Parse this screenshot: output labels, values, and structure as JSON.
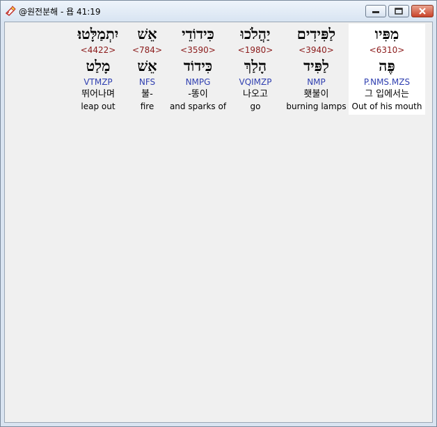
{
  "window": {
    "title": "@원전분해 - 욥 41:19",
    "controls": {
      "minimize": "minimize",
      "maximize": "maximize",
      "close": "close"
    }
  },
  "verse": {
    "words": [
      {
        "hebrew": "מִפִּיו",
        "strong": "<6310>",
        "lemma": "פֶּה",
        "morph": "P.NMS.MZS",
        "korean": "그 입에서는",
        "english": "Out of his mouth",
        "active": true
      },
      {
        "hebrew": "לַפִּידִים",
        "strong": "<3940>",
        "lemma": "לַפִּיד",
        "morph": "NMP",
        "korean": "횃불이",
        "english": "burning lamps",
        "active": false
      },
      {
        "hebrew": "יַהֲלֹכוּ",
        "strong": "<1980>",
        "lemma": "הָלַךְ",
        "morph": "VQIMZP",
        "korean": "나오고",
        "english": "go",
        "active": false
      },
      {
        "hebrew": "כִּידוֹדֵי",
        "strong": "<3590>",
        "lemma": "כִּידוֹד",
        "morph": "NMPG",
        "korean": "-똥이",
        "english": "and sparks of",
        "active": false
      },
      {
        "hebrew": "אֵשׁ",
        "strong": "<784>",
        "lemma": "אֵשׁ",
        "morph": "NFS",
        "korean": "불-",
        "english": "fire",
        "active": false
      },
      {
        "hebrew": "יִתְמַלָּטוּ׃",
        "strong": "<4422>",
        "lemma": "מָלַט",
        "morph": "VTMZP",
        "korean": "뛰어나며",
        "english": "leap out",
        "active": false
      }
    ]
  }
}
